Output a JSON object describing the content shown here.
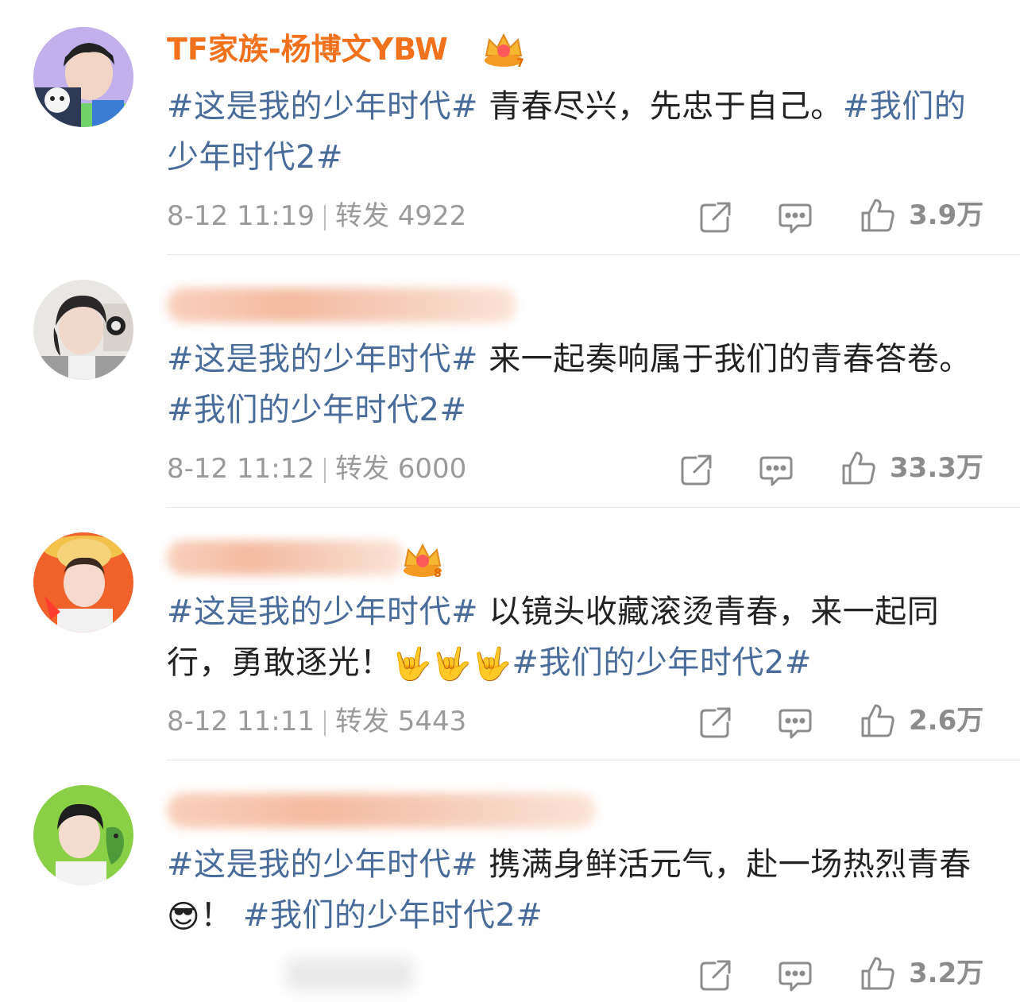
{
  "posts": [
    {
      "author": "TF家族-杨博文YBW",
      "author_blurred": false,
      "text_tag": "#这是我的少年时代#",
      "text_body": " 青春尽兴，先忠于自己。",
      "text_tag2": "#我们的少年时代2#",
      "time": "8-12 11:19",
      "repost_label": "转发",
      "repost_count": "4922",
      "likes": "3.9万",
      "icons": [
        "share-icon",
        "comment-icon",
        "like-icon"
      ]
    },
    {
      "author": "",
      "author_blurred": true,
      "text_tag": "#这是我的少年时代#",
      "text_body": " 来一起奏响属于我们的青春答卷。",
      "text_tag2": "#我们的少年时代2#",
      "time": "8-12 11:12",
      "repost_label": "转发",
      "repost_count": "6000",
      "likes": "33.3万",
      "icons": [
        "share-icon",
        "comment-icon",
        "like-icon"
      ]
    },
    {
      "author": "",
      "author_blurred": true,
      "text_tag": "#这是我的少年时代#",
      "text_body": " 以镜头收藏滚烫青春，来一起同行，勇敢逐光！",
      "text_emoji": "🤟🤟🤟",
      "text_tag2": "#我们的少年时代2#",
      "time": "8-12 11:11",
      "repost_label": "转发",
      "repost_count": "5443",
      "likes": "2.6万",
      "icons": [
        "share-icon",
        "comment-icon",
        "like-icon"
      ]
    },
    {
      "author": "",
      "author_blurred": true,
      "text_tag": "#这是我的少年时代#",
      "text_body": " 携满身鲜活元气，赴一场热烈青春",
      "text_emoji": "😎",
      "text_after_emoji": "！",
      "text_tag2": "#我们的少年时代2#",
      "time": "",
      "repost_label": "",
      "repost_count": "",
      "likes": "3.2万",
      "icons": [
        "share-icon",
        "comment-icon",
        "like-icon"
      ]
    }
  ],
  "colors": {
    "author_name": "#f2711c",
    "hashtag": "#4a6c9b",
    "meta": "#9a9a9a",
    "divider": "#e6e6e6"
  }
}
